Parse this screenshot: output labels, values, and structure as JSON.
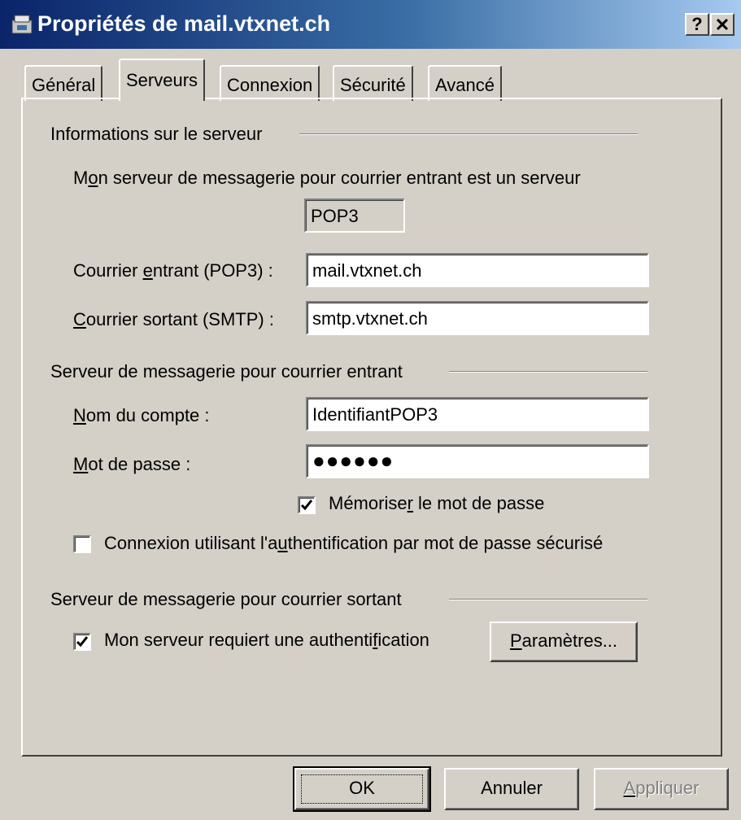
{
  "window": {
    "title": "Propriétés de mail.vtxnet.ch",
    "help_label": "?",
    "close_label": "✕"
  },
  "tabs": [
    {
      "label": "Général",
      "active": false
    },
    {
      "label": "Serveurs",
      "active": true
    },
    {
      "label": "Connexion",
      "active": false
    },
    {
      "label": "Sécurité",
      "active": false
    },
    {
      "label": "Avancé",
      "active": false
    }
  ],
  "server_info": {
    "group_label": "Informations sur le serveur",
    "incoming_type_label": {
      "pre": "M",
      "ul": "o",
      "post": "n serveur de messagerie pour courrier entrant est un serveur"
    },
    "incoming_type_value": "POP3",
    "incoming_label": {
      "pre": "Courrier ",
      "ul": "e",
      "post": "ntrant (POP3) :"
    },
    "incoming_value": "mail.vtxnet.ch",
    "outgoing_label": {
      "pre": "",
      "ul": "C",
      "post": "ourrier sortant (SMTP) :"
    },
    "outgoing_value": "smtp.vtxnet.ch"
  },
  "incoming_server": {
    "group_label": "Serveur de messagerie pour courrier entrant",
    "account_label": {
      "pre": "",
      "ul": "N",
      "post": "om du compte :"
    },
    "account_value": "IdentifiantPOP3",
    "password_label": {
      "pre": "",
      "ul": "M",
      "post": "ot de passe :"
    },
    "password_value": "●●●●●●",
    "remember_label": {
      "pre": "Mémorise",
      "ul": "r",
      "post": " le mot de passe"
    },
    "remember_checked": true,
    "spa_label": {
      "pre": "Connexion utilisant l'a",
      "ul": "u",
      "post": "thentification par mot de passe sécurisé"
    },
    "spa_checked": false
  },
  "outgoing_server": {
    "group_label": "Serveur de messagerie pour courrier sortant",
    "auth_label": {
      "pre": "Mon serveur requiert une authenti",
      "ul": "f",
      "post": "ication"
    },
    "auth_checked": true,
    "settings_button": {
      "pre": "",
      "ul": "P",
      "post": "aramètres..."
    }
  },
  "footer": {
    "ok_label": "OK",
    "cancel_label": "Annuler",
    "apply_label": {
      "pre": "",
      "ul": "A",
      "post": "ppliquer"
    }
  },
  "colors": {
    "titlebar_start": "#0a246a",
    "titlebar_end": "#a6caf0",
    "face": "#d4d0c8"
  }
}
